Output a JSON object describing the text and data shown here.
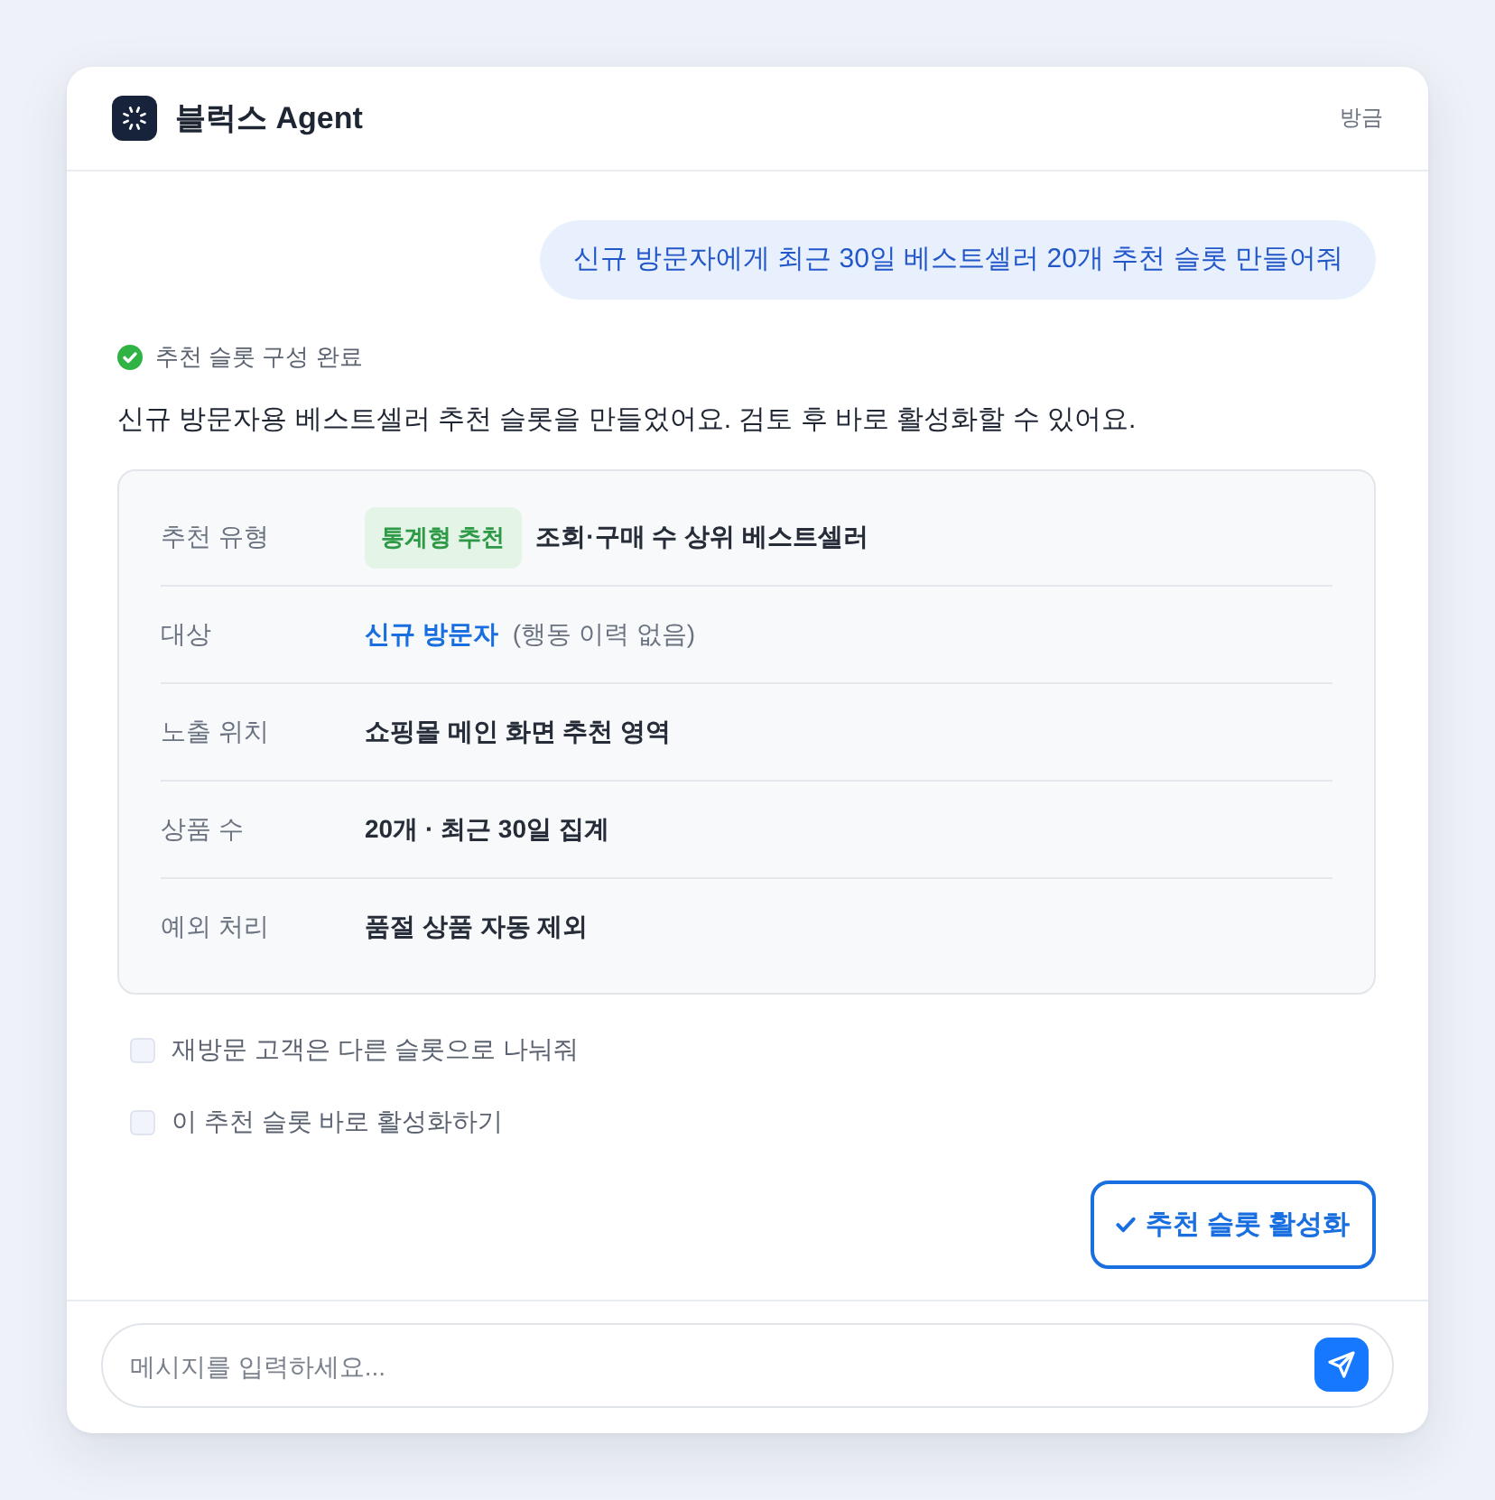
{
  "header": {
    "title": "블럭스 Agent",
    "timestamp": "방금"
  },
  "user_message": {
    "text": "신규 방문자에게 최근 30일 베스트셀러 20개 추천 슬롯 만들어줘"
  },
  "agent": {
    "status": "추천 슬롯 구성 완료",
    "message": "신규 방문자용 베스트셀러 추천 슬롯을 만들었어요. 검토 후 바로 활성화할 수 있어요."
  },
  "details": [
    {
      "label": "추천 유형",
      "badge": "통계형 추천",
      "value": "조회·구매 수 상위 베스트셀러"
    },
    {
      "label": "대상",
      "highlight": "신규 방문자",
      "note": "(행동 이력 없음)"
    },
    {
      "label": "노출 위치",
      "value": "쇼핑몰 메인 화면 추천 영역"
    },
    {
      "label": "상품 수",
      "value": "20개 · 최근 30일 집계"
    },
    {
      "label": "예외 처리",
      "value": "품절 상품 자동 제외"
    }
  ],
  "options": [
    {
      "label": "재방문 고객은 다른 슬롯으로 나눠줘",
      "checked": false
    },
    {
      "label": "이 추천 슬롯 바로 활성화하기",
      "checked": false
    }
  ],
  "action_button": {
    "label": "추천 슬롯 활성화"
  },
  "composer": {
    "placeholder": "메시지를 입력하세요..."
  }
}
